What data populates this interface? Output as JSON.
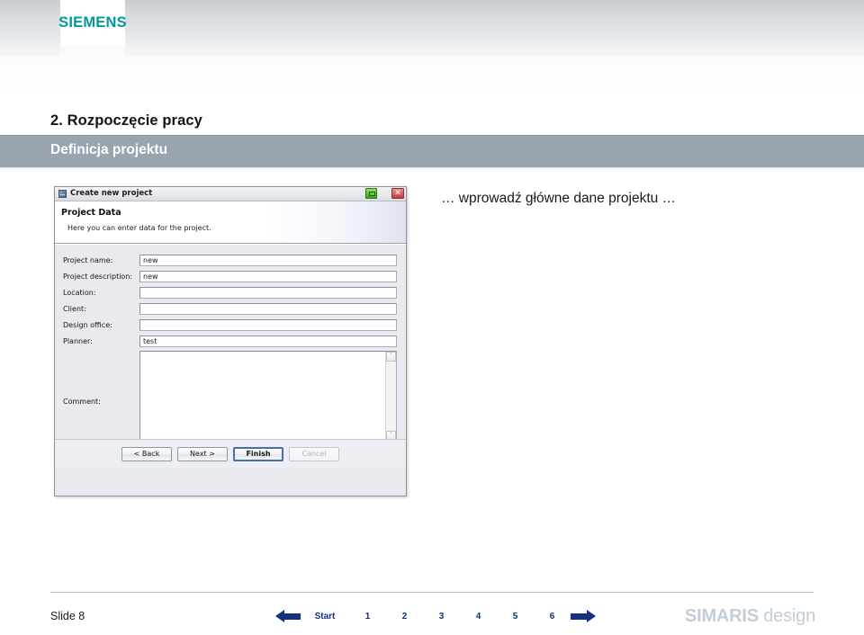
{
  "header": {
    "logo_text": "SIEMENS"
  },
  "title": {
    "heading": "2. Rozpoczęcie pracy",
    "subheading": "Definicja projektu"
  },
  "annotation": {
    "text": "… wprowadź główne dane projektu …"
  },
  "dialog": {
    "window_title": "Create new project",
    "window_icon": "window-app-icon",
    "help_icon": "green-help-icon",
    "close_icon": "close-icon",
    "close_glyph": "✕",
    "header_title": "Project Data",
    "header_subtitle": "Here you can enter data for the project.",
    "fields": [
      {
        "label": "Project name:",
        "value": "new"
      },
      {
        "label": "Project description:",
        "value": "new"
      },
      {
        "label": "Location:",
        "value": ""
      },
      {
        "label": "Client:",
        "value": ""
      },
      {
        "label": "Design office:",
        "value": ""
      },
      {
        "label": "Planner:",
        "value": "test"
      }
    ],
    "comment": {
      "label": "Comment:",
      "value": ""
    },
    "scroll": {
      "up": "˄",
      "down": "˅",
      "left": "‹",
      "right": "›"
    },
    "buttons": [
      {
        "label": "< Back",
        "state": "normal"
      },
      {
        "label": "Next >",
        "state": "normal"
      },
      {
        "label": "Finish",
        "state": "default"
      },
      {
        "label": "Cancel",
        "state": "disabled"
      }
    ]
  },
  "footer": {
    "slide_label": "Slide 8",
    "nav_start": "Start",
    "nav_numbers": [
      "1",
      "2",
      "3",
      "4",
      "5",
      "6"
    ],
    "brand_bold": "SIMARIS",
    "brand_light": " design"
  },
  "colors": {
    "siemens_teal": "#009999",
    "band_gray": "#98a4b0",
    "nav_blue": "#14307f",
    "brand_gray": "#c3cdd8"
  }
}
